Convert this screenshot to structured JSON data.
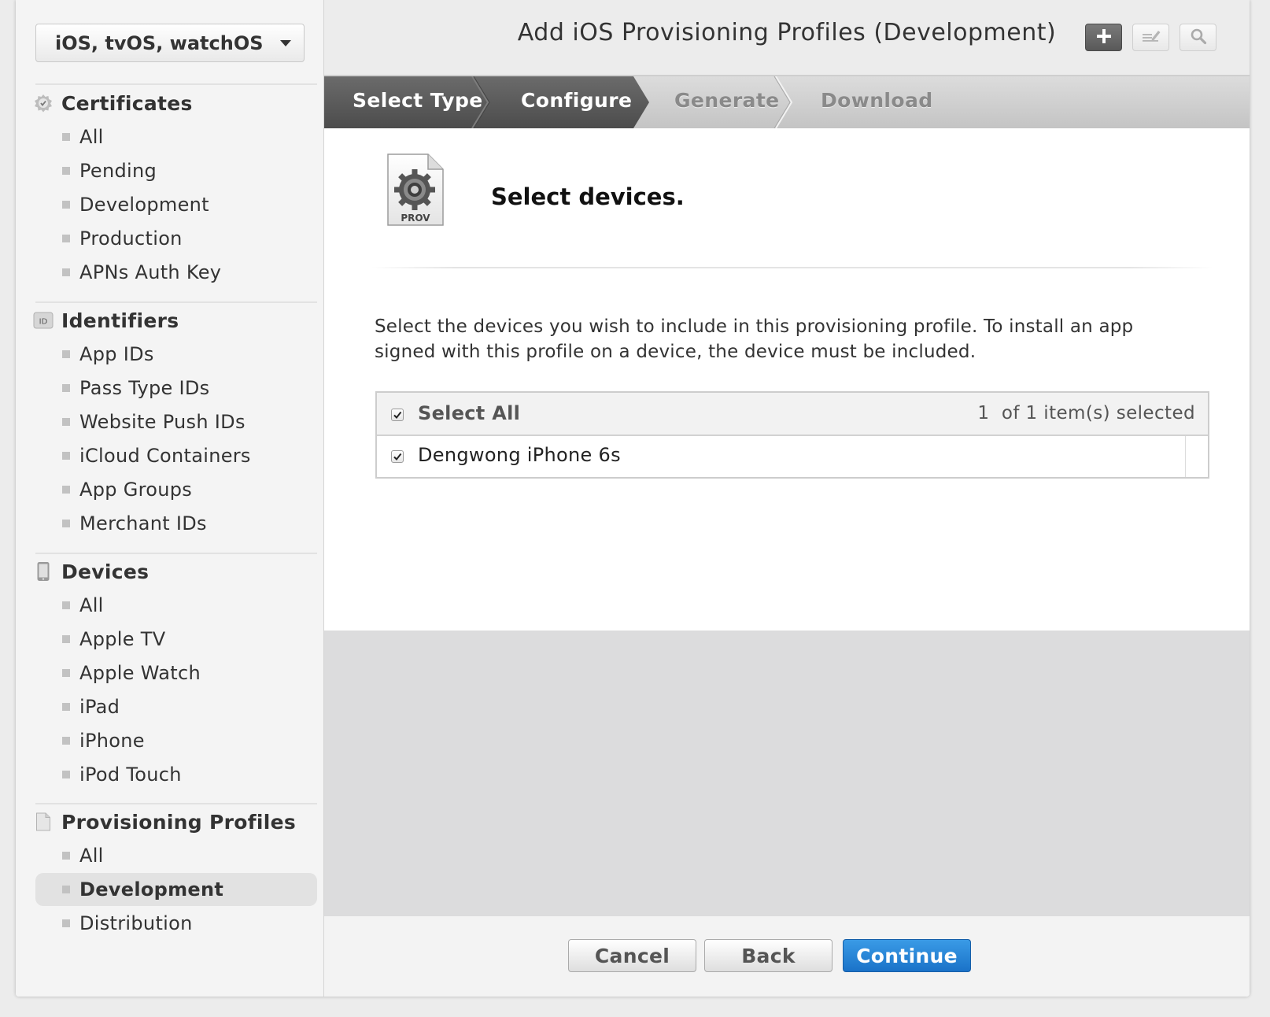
{
  "sidebar": {
    "platform_select": "iOS, tvOS, watchOS",
    "sections": [
      {
        "title": "Certificates",
        "icon": "certificate-icon",
        "items": [
          "All",
          "Pending",
          "Development",
          "Production",
          "APNs Auth Key"
        ]
      },
      {
        "title": "Identifiers",
        "icon": "id-badge-icon",
        "icon_text": "ID",
        "items": [
          "App IDs",
          "Pass Type IDs",
          "Website Push IDs",
          "iCloud Containers",
          "App Groups",
          "Merchant IDs"
        ]
      },
      {
        "title": "Devices",
        "icon": "device-icon",
        "items": [
          "All",
          "Apple TV",
          "Apple Watch",
          "iPad",
          "iPhone",
          "iPod Touch"
        ]
      },
      {
        "title": "Provisioning Profiles",
        "icon": "document-icon",
        "items": [
          "All",
          "Development",
          "Distribution"
        ],
        "active_item": "Development"
      }
    ]
  },
  "header": {
    "title": "Add iOS Provisioning Profiles (Development)",
    "icons": [
      "plus-icon",
      "edit-icon",
      "search-icon"
    ]
  },
  "steps": [
    {
      "label": "Select Type",
      "state": "done"
    },
    {
      "label": "Configure",
      "state": "current"
    },
    {
      "label": "Generate",
      "state": "todo"
    },
    {
      "label": "Download",
      "state": "todo"
    }
  ],
  "content": {
    "icon_label": "PROV",
    "heading": "Select devices.",
    "description": "Select the devices you wish to include in this provisioning profile. To install an app signed with this profile on a device, the device must be included.",
    "table": {
      "select_all_label": "Select All",
      "selected_count": "1  of 1 item(s) selected",
      "select_all_checked": true,
      "rows": [
        {
          "name": "Dengwong iPhone 6s",
          "checked": true
        }
      ]
    }
  },
  "footer": {
    "cancel": "Cancel",
    "back": "Back",
    "continue": "Continue"
  },
  "colors": {
    "primary_button": "#1a72c8",
    "step_done": "#5c5c5c",
    "step_todo": "#c8c8c8"
  }
}
